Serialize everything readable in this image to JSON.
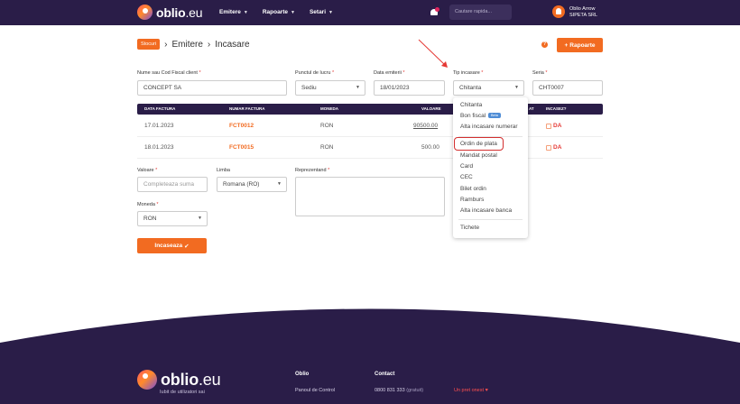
{
  "header": {
    "brand_bold": "oblio",
    "brand_light": ".eu",
    "nav": [
      {
        "label": "Emitere"
      },
      {
        "label": "Rapoarte"
      },
      {
        "label": "Setari"
      }
    ],
    "search_placeholder": "Cautare rapida...",
    "user_name": "Oblio Arrow",
    "user_company": "SIPETA SRL"
  },
  "breadcrumb": {
    "badge": "Stocuri",
    "items": [
      "Emitere",
      "Incasare"
    ]
  },
  "actions": {
    "help": "?",
    "reports_label": "Rapoarte",
    "reports_prefix": "+"
  },
  "form": {
    "client_label": "Nume sau Cod Fiscal client",
    "client_value": "CONCEPT SA",
    "location_label": "Punctul de lucru",
    "location_value": "Sediu",
    "date_label": "Data emiterii",
    "date_value": "18/01/2023",
    "type_label": "Tip incasare",
    "type_value": "Chitanta",
    "series_label": "Seria",
    "series_value": "CHT0007",
    "amount_label": "Valoare",
    "amount_placeholder": "Completeaza suma",
    "language_label": "Limba",
    "language_value": "Romana (RO)",
    "rep_label": "Reprezentand",
    "currency_label": "Moneda",
    "currency_value": "RON",
    "submit_label": "Incaseaza",
    "required_mark": "*"
  },
  "table": {
    "headers": [
      "DATA FACTURA",
      "NUMAR FACTURA",
      "MONEDA",
      "VALOARE",
      "AT",
      "INCASEZ?"
    ],
    "rows": [
      {
        "date": "17.01.2023",
        "number": "FCT0012",
        "currency": "RON",
        "value": "90500.00",
        "paid": "DA"
      },
      {
        "date": "18.01.2023",
        "number": "FCT0015",
        "currency": "RON",
        "value": "500.00",
        "paid": "DA"
      }
    ]
  },
  "dropdown": {
    "options_top": [
      "Chitanta",
      "Bon fiscal",
      "Alta incasare numerar"
    ],
    "beta_badge": "Beta",
    "options_mid": [
      "Ordin de plata",
      "Mandat postal",
      "Card",
      "CEC",
      "Bilet ordin",
      "Ramburs",
      "Alta incasare banca"
    ],
    "options_bottom": [
      "Tichete"
    ],
    "highlighted": "Ordin de plata"
  },
  "footer": {
    "tagline": "Iubit de utilizatori sai",
    "col1_title": "Oblio",
    "col1_link": "Panoul de Control",
    "col2_title": "Contact",
    "phone": "0800 831 333",
    "phone_note": "(gratuit)",
    "price_note": "Un pret onest",
    "heart": "♥"
  },
  "colors": {
    "primary_dark": "#2a1d48",
    "accent": "#f26b21",
    "highlight_red": "#d32f2f",
    "beta_blue": "#4f8dd6"
  }
}
